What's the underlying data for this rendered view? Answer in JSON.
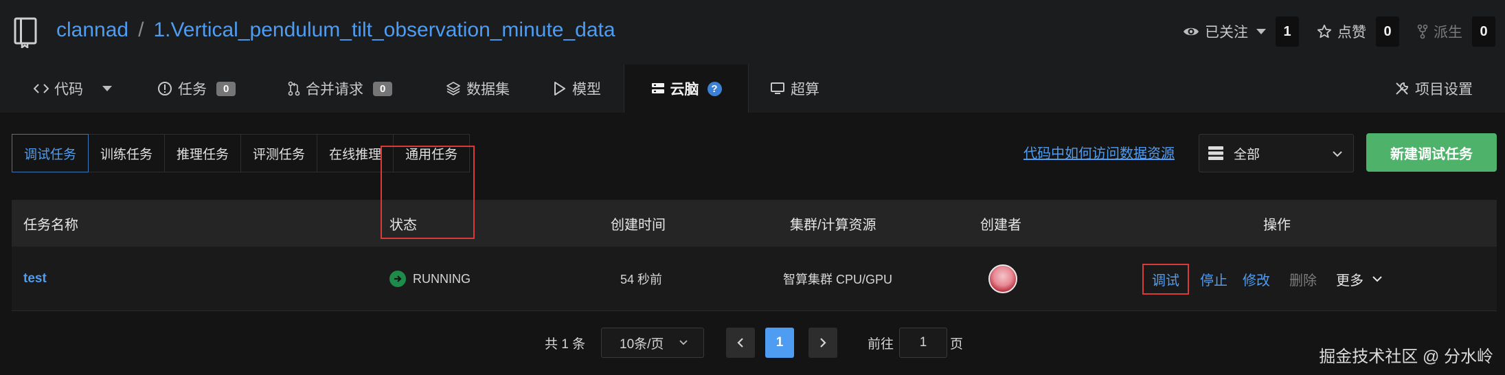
{
  "header": {
    "owner": "clannad",
    "separator": "/",
    "repo": "1.Vertical_pendulum_tilt_observation_minute_data",
    "watch_label": "已关注",
    "watch_count": "1",
    "star_label": "点赞",
    "star_count": "0",
    "fork_label": "派生",
    "fork_count": "0"
  },
  "tabs": {
    "code": "代码",
    "issues": "任务",
    "issues_count": "0",
    "pulls": "合并请求",
    "pulls_count": "0",
    "datasets": "数据集",
    "models": "模型",
    "cloudbrain": "云脑",
    "cloudbrain_help": "?",
    "supercompute": "超算",
    "settings": "项目设置"
  },
  "subtabs": [
    "调试任务",
    "训练任务",
    "推理任务",
    "评测任务",
    "在线推理",
    "通用任务"
  ],
  "toolbar": {
    "doc_link": "代码中如何访问数据资源",
    "filter_value": "全部",
    "new_button": "新建调试任务"
  },
  "table": {
    "headers": [
      "任务名称",
      "状态",
      "创建时间",
      "集群/计算资源",
      "创建者",
      "操作"
    ],
    "rows": [
      {
        "name": "test",
        "status": "RUNNING",
        "created": "54 秒前",
        "resource": "智算集群 CPU/GPU",
        "actions": {
          "debug": "调试",
          "stop": "停止",
          "edit": "修改",
          "delete": "删除",
          "more": "更多"
        }
      }
    ]
  },
  "pagination": {
    "total": "共 1 条",
    "page_size": "10条/页",
    "current_page": "1",
    "goto_label": "前往",
    "goto_value": "1",
    "page_unit": "页"
  },
  "watermark": "掘金技术社区 @ 分水岭",
  "colors": {
    "accent": "#4e9df3",
    "success": "#4fb26a",
    "highlight": "#d93a3a"
  }
}
